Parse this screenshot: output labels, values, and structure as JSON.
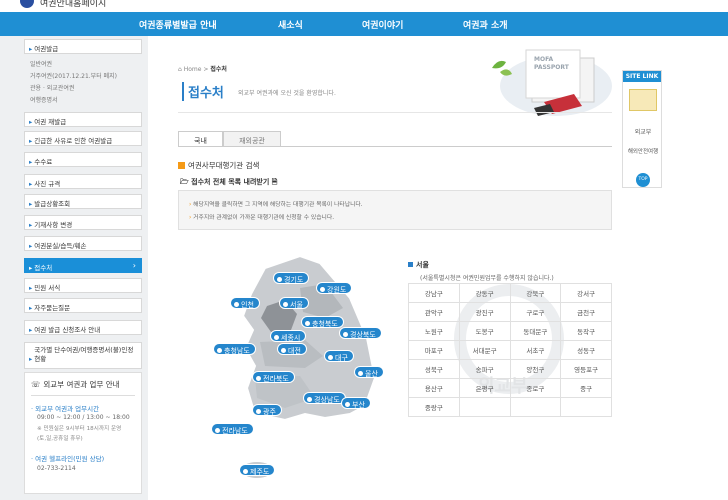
{
  "header": {
    "site_title": "여권안내홈페이지"
  },
  "nav": [
    "여권종류별발급 안내",
    "새소식",
    "여권이야기",
    "여권과 소개"
  ],
  "sidebar": {
    "top_item": "여권발급",
    "sub_items": [
      "일반여권",
      "거주여권(2017.12.21.부터 폐지)",
      "관용 · 외교관여권",
      "여행증명서"
    ],
    "items": [
      "여권 재발급",
      "긴급한 사유로 인한 여권발급",
      "수수료",
      "사진 규격",
      "발급상황조회",
      "기재사항 변경",
      "여권분실/습득/훼손",
      "접수처",
      "민원 서식",
      "자주묻는질문",
      "여권 발급 신청조사 안내",
      "국가별 단수여권/여행증명서(불)인정 현황"
    ],
    "active_index": 7
  },
  "infobox": {
    "title": "외교부 여권과 업무 안내",
    "hours_label": "외교부 여권과 업무시간",
    "hours": "09:00 ~ 12:00 / 13:00 ~ 18:00",
    "hours_note1": "※ 민원실은 9시부터 18시까지 운영",
    "hours_note2": "(토,일,공휴일 휴무)",
    "help_label": "여권 헬프라인(민원 상담)",
    "help_phone": "02-733-2114"
  },
  "breadcrumb": {
    "home": "Home",
    "sep": ">",
    "current": "접수처"
  },
  "page": {
    "title": "접수처",
    "description": "외교부 여권과에 오신 것을 환영합니다."
  },
  "tabs": [
    "국내",
    "재외공관"
  ],
  "section_title": "여권사무대행기관 검색",
  "download_link": "접수처 전체 목록 내려받기",
  "notes": [
    "해당지역을 클릭하면 그 지역에 해당하는 대행기관 목록이 나타납니다.",
    "거주지와 관계없이 가까운 대행기관에 신청할 수 있습니다."
  ],
  "map_regions": [
    "경기도",
    "강원도",
    "인천",
    "서울",
    "충청북도",
    "세종시",
    "경상북도",
    "충청남도",
    "대전",
    "대구",
    "전라북도",
    "울산",
    "경상남도",
    "광주",
    "부산",
    "전라남도",
    "제주도"
  ],
  "seoul": {
    "title": "서울",
    "note": "(서울특별시청은 여권민원업무를 수행하지 않습니다.)",
    "districts": [
      [
        "강남구",
        "강동구",
        "강북구",
        "강서구"
      ],
      [
        "관악구",
        "광진구",
        "구로구",
        "금천구"
      ],
      [
        "노원구",
        "도봉구",
        "동대문구",
        "동작구"
      ],
      [
        "마포구",
        "서대문구",
        "서초구",
        "성동구"
      ],
      [
        "성북구",
        "송파구",
        "양천구",
        "영등포구"
      ],
      [
        "용산구",
        "은평구",
        "종로구",
        "중구"
      ],
      [
        "중랑구",
        "",
        "",
        ""
      ]
    ]
  },
  "site_link": {
    "header": "SITE LINK",
    "items": [
      "외교부",
      "해외안전여행"
    ],
    "top": "TOP"
  },
  "banner": {
    "line1": "MOFA",
    "line2": "PASSPORT"
  },
  "watermark": "외교부",
  "colors": {
    "nav": "#1f8fd3",
    "accent": "#f59a16",
    "region": "#2586cc"
  }
}
